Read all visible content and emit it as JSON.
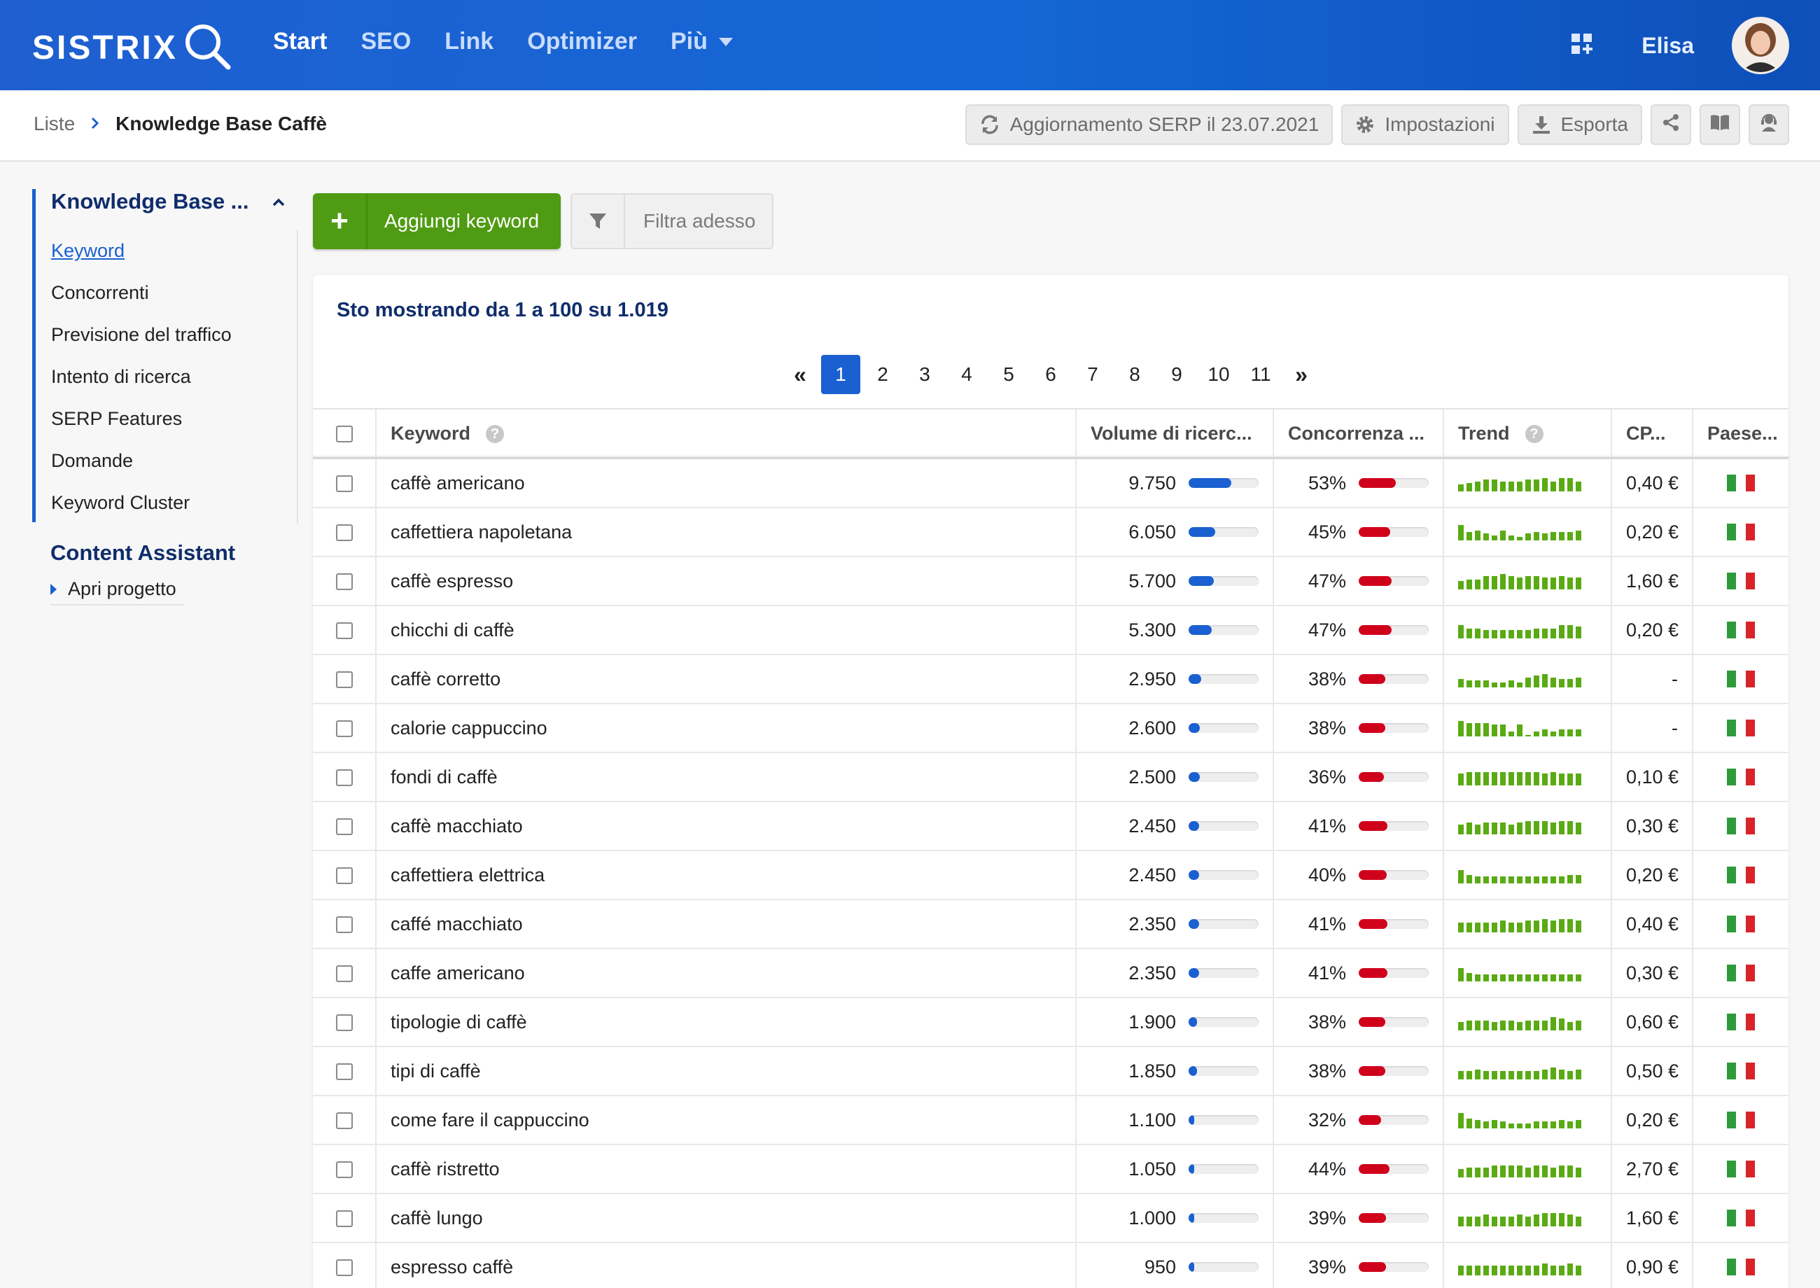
{
  "app": {
    "logo": "SISTRIX",
    "nav": [
      {
        "label": "Start",
        "active": true
      },
      {
        "label": "SEO",
        "active": false
      },
      {
        "label": "Link",
        "active": false
      },
      {
        "label": "Optimizer",
        "active": false
      },
      {
        "label": "Più",
        "active": false
      }
    ],
    "user_name": "Elisa"
  },
  "breadcrumb": {
    "root": "Liste",
    "current": "Knowledge Base Caffè"
  },
  "toolbar": {
    "serp_update_label": "Aggiornamento SERP il 23.07.2021",
    "settings_label": "Impostazioni",
    "export_label": "Esporta"
  },
  "sidebar": {
    "project_title": "Knowledge Base ...",
    "items": [
      {
        "label": "Keyword",
        "active": true
      },
      {
        "label": "Concorrenti"
      },
      {
        "label": "Previsione del traffico"
      },
      {
        "label": "Intento di ricerca"
      },
      {
        "label": "SERP Features"
      },
      {
        "label": "Domande"
      },
      {
        "label": "Keyword Cluster"
      }
    ],
    "content_assistant_title": "Content Assistant",
    "content_assistant_item": "Apri progetto"
  },
  "actions": {
    "add_keyword_label": "Aggiungi keyword",
    "filter_label": "Filtra adesso"
  },
  "results": {
    "showing_text": "Sto mostrando da 1 a 100 su 1.019"
  },
  "pagination": {
    "pages": [
      "1",
      "2",
      "3",
      "4",
      "5",
      "6",
      "7",
      "8",
      "9",
      "10",
      "11"
    ],
    "current": "1",
    "first_label": "«",
    "last_label": "»"
  },
  "table": {
    "columns": {
      "keyword": "Keyword",
      "volume": "Volume di ricerc...",
      "competition": "Concorrenza ...",
      "trend": "Trend",
      "cpc": "CP...",
      "country": "Paese..."
    },
    "colors": {
      "volume_bar": "#1a60d0",
      "competition_bar": "#d0021b",
      "trend_bar": "#5aaa14"
    },
    "volume_scale_max": 16000,
    "rows": [
      {
        "keyword": "caffè americano",
        "volume": "9.750",
        "volume_value": 9750,
        "competition": "53%",
        "competition_value": 53,
        "cpc": "0,40 €",
        "trend": [
          0.4,
          0.5,
          0.6,
          0.7,
          0.7,
          0.6,
          0.6,
          0.6,
          0.7,
          0.7,
          0.8,
          0.6,
          0.8,
          0.8,
          0.6
        ],
        "country": "it"
      },
      {
        "keyword": "caffettiera napoletana",
        "volume": "6.050",
        "volume_value": 6050,
        "competition": "45%",
        "competition_value": 45,
        "cpc": "0,20 €",
        "trend": [
          0.9,
          0.5,
          0.6,
          0.4,
          0.3,
          0.6,
          0.3,
          0.2,
          0.4,
          0.5,
          0.4,
          0.5,
          0.5,
          0.5,
          0.6
        ],
        "country": "it"
      },
      {
        "keyword": "caffè espresso",
        "volume": "5.700",
        "volume_value": 5700,
        "competition": "47%",
        "competition_value": 47,
        "cpc": "1,60 €",
        "trend": [
          0.5,
          0.6,
          0.6,
          0.8,
          0.8,
          0.9,
          0.8,
          0.7,
          0.8,
          0.8,
          0.7,
          0.7,
          0.8,
          0.7,
          0.7
        ],
        "country": "it"
      },
      {
        "keyword": "chicchi di caffè",
        "volume": "5.300",
        "volume_value": 5300,
        "competition": "47%",
        "competition_value": 47,
        "cpc": "0,20 €",
        "trend": [
          0.8,
          0.6,
          0.6,
          0.5,
          0.5,
          0.5,
          0.5,
          0.5,
          0.5,
          0.6,
          0.6,
          0.6,
          0.8,
          0.8,
          0.7
        ],
        "country": "it"
      },
      {
        "keyword": "caffè corretto",
        "volume": "2.950",
        "volume_value": 2950,
        "competition": "38%",
        "competition_value": 38,
        "cpc": "-",
        "trend": [
          0.5,
          0.4,
          0.4,
          0.4,
          0.3,
          0.3,
          0.4,
          0.3,
          0.6,
          0.7,
          0.8,
          0.6,
          0.5,
          0.5,
          0.6
        ],
        "country": "it"
      },
      {
        "keyword": "calorie cappuccino",
        "volume": "2.600",
        "volume_value": 2600,
        "competition": "38%",
        "competition_value": 38,
        "cpc": "-",
        "trend": [
          0.9,
          0.8,
          0.8,
          0.8,
          0.7,
          0.7,
          0.3,
          0.7,
          0.1,
          0.3,
          0.4,
          0.3,
          0.4,
          0.4,
          0.4
        ],
        "country": "it"
      },
      {
        "keyword": "fondi di caffè",
        "volume": "2.500",
        "volume_value": 2500,
        "competition": "36%",
        "competition_value": 36,
        "cpc": "0,10 €",
        "trend": [
          0.7,
          0.8,
          0.8,
          0.8,
          0.8,
          0.8,
          0.8,
          0.8,
          0.8,
          0.8,
          0.7,
          0.8,
          0.7,
          0.7,
          0.7
        ],
        "country": "it"
      },
      {
        "keyword": "caffè macchiato",
        "volume": "2.450",
        "volume_value": 2450,
        "competition": "41%",
        "competition_value": 41,
        "cpc": "0,30 €",
        "trend": [
          0.6,
          0.7,
          0.6,
          0.7,
          0.7,
          0.7,
          0.6,
          0.7,
          0.8,
          0.8,
          0.8,
          0.7,
          0.8,
          0.8,
          0.7
        ],
        "country": "it"
      },
      {
        "keyword": "caffettiera elettrica",
        "volume": "2.450",
        "volume_value": 2450,
        "competition": "40%",
        "competition_value": 40,
        "cpc": "0,20 €",
        "trend": [
          0.8,
          0.5,
          0.4,
          0.4,
          0.4,
          0.4,
          0.4,
          0.4,
          0.4,
          0.4,
          0.4,
          0.4,
          0.4,
          0.5,
          0.5
        ],
        "country": "it"
      },
      {
        "keyword": "caffé macchiato",
        "volume": "2.350",
        "volume_value": 2350,
        "competition": "41%",
        "competition_value": 41,
        "cpc": "0,40 €",
        "trend": [
          0.6,
          0.6,
          0.6,
          0.6,
          0.6,
          0.7,
          0.6,
          0.6,
          0.7,
          0.7,
          0.8,
          0.7,
          0.8,
          0.8,
          0.7
        ],
        "country": "it"
      },
      {
        "keyword": "caffe americano",
        "volume": "2.350",
        "volume_value": 2350,
        "competition": "41%",
        "competition_value": 41,
        "cpc": "0,30 €",
        "trend": [
          0.8,
          0.5,
          0.4,
          0.4,
          0.4,
          0.4,
          0.4,
          0.4,
          0.4,
          0.4,
          0.4,
          0.4,
          0.4,
          0.4,
          0.4
        ],
        "country": "it"
      },
      {
        "keyword": "tipologie di caffè",
        "volume": "1.900",
        "volume_value": 1900,
        "competition": "38%",
        "competition_value": 38,
        "cpc": "0,60 €",
        "trend": [
          0.5,
          0.6,
          0.6,
          0.6,
          0.5,
          0.6,
          0.6,
          0.5,
          0.6,
          0.6,
          0.6,
          0.8,
          0.7,
          0.5,
          0.6
        ],
        "country": "it"
      },
      {
        "keyword": "tipi di caffè",
        "volume": "1.850",
        "volume_value": 1850,
        "competition": "38%",
        "competition_value": 38,
        "cpc": "0,50 €",
        "trend": [
          0.5,
          0.5,
          0.6,
          0.5,
          0.5,
          0.5,
          0.5,
          0.5,
          0.5,
          0.5,
          0.6,
          0.7,
          0.6,
          0.5,
          0.6
        ],
        "country": "it"
      },
      {
        "keyword": "come fare il cappuccino",
        "volume": "1.100",
        "volume_value": 1100,
        "competition": "32%",
        "competition_value": 32,
        "cpc": "0,20 €",
        "trend": [
          0.9,
          0.6,
          0.5,
          0.4,
          0.5,
          0.4,
          0.3,
          0.3,
          0.3,
          0.4,
          0.4,
          0.4,
          0.5,
          0.4,
          0.5
        ],
        "country": "it"
      },
      {
        "keyword": "caffè ristretto",
        "volume": "1.050",
        "volume_value": 1050,
        "competition": "44%",
        "competition_value": 44,
        "cpc": "2,70 €",
        "trend": [
          0.5,
          0.6,
          0.6,
          0.6,
          0.7,
          0.7,
          0.7,
          0.7,
          0.6,
          0.7,
          0.7,
          0.6,
          0.7,
          0.7,
          0.6
        ],
        "country": "it"
      },
      {
        "keyword": "caffè lungo",
        "volume": "1.000",
        "volume_value": 1000,
        "competition": "39%",
        "competition_value": 39,
        "cpc": "1,60 €",
        "trend": [
          0.6,
          0.6,
          0.6,
          0.7,
          0.6,
          0.6,
          0.6,
          0.7,
          0.6,
          0.7,
          0.8,
          0.8,
          0.8,
          0.7,
          0.6
        ],
        "country": "it"
      },
      {
        "keyword": "espresso caffè",
        "volume": "950",
        "volume_value": 950,
        "competition": "39%",
        "competition_value": 39,
        "cpc": "0,90 €",
        "trend": [
          0.6,
          0.6,
          0.6,
          0.6,
          0.6,
          0.6,
          0.6,
          0.6,
          0.6,
          0.6,
          0.7,
          0.6,
          0.6,
          0.7,
          0.6
        ],
        "country": "it"
      }
    ]
  }
}
